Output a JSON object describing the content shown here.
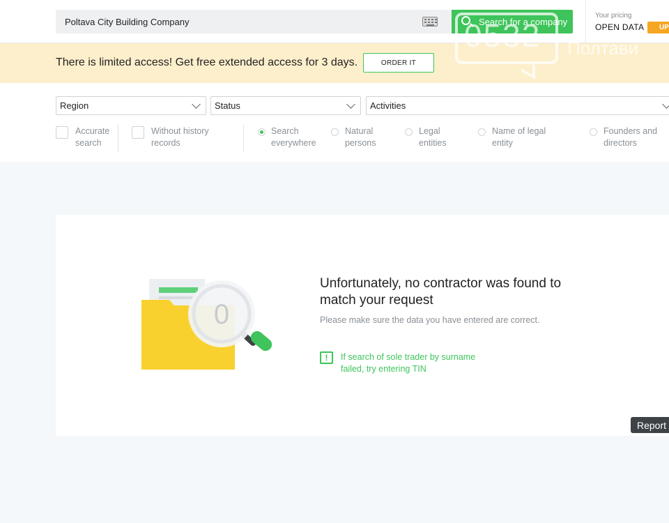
{
  "header": {
    "search_value": "Poltava City Building Company",
    "search_button_label": "Search for a company",
    "pricing_caption": "Your pricing",
    "pricing_plan": "OPEN DATA",
    "upgrade_label": "UP"
  },
  "watermark": {
    "number": "0532",
    "city": "Полтави"
  },
  "banner": {
    "message": "There is limited access! Get free extended access for 3 days.",
    "order_label": "ORDER IT"
  },
  "filters": {
    "region": "Region",
    "status": "Status",
    "activities": "Activities",
    "checkboxes": [
      {
        "label_line1": "Accurate",
        "label_line2": "search",
        "checked": false
      },
      {
        "label_line1": "Without history",
        "label_line2": "records",
        "checked": false
      }
    ],
    "radios": [
      {
        "label_line1": "Search",
        "label_line2": "everywhere",
        "selected": true
      },
      {
        "label_line1": "Natural",
        "label_line2": "persons",
        "selected": false
      },
      {
        "label_line1": "Legal",
        "label_line2": "entities",
        "selected": false
      },
      {
        "label_line1": "Name of legal",
        "label_line2": "entity",
        "selected": false
      },
      {
        "label_line1": "Founders and",
        "label_line2": "directors",
        "selected": false
      }
    ]
  },
  "result": {
    "badge_count": "0",
    "title_line1": "Unfortunately, no contractor was found to",
    "title_line2": "match your request",
    "subtitle": "Please make sure the data you have entered are correct.",
    "tip_line1": "If search of sole trader by surname",
    "tip_line2": "failed, try entering TIN"
  },
  "report_label": "Report",
  "colors": {
    "accent_green": "#3ec45a",
    "banner_bg": "#fdefcc",
    "folder_yellow": "#f9d12e",
    "upgrade_orange": "#f5a623"
  }
}
